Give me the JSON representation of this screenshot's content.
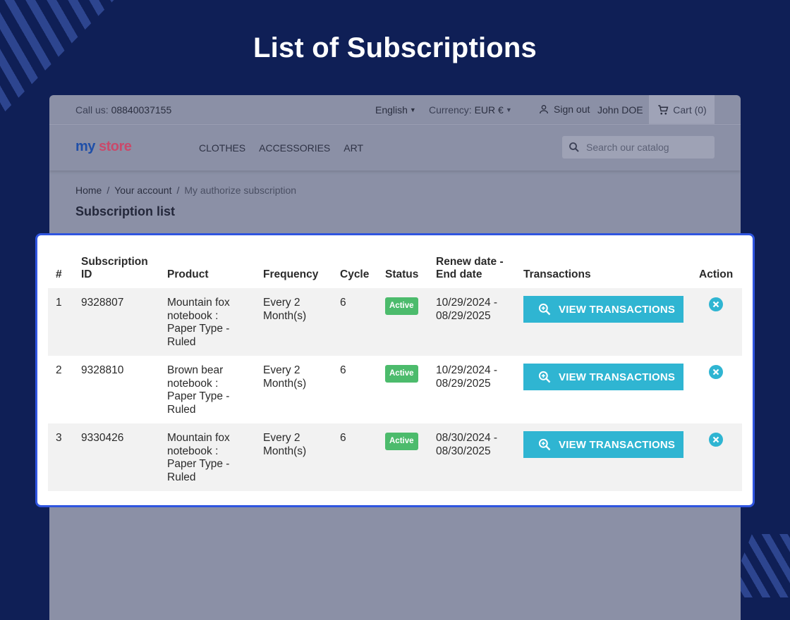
{
  "headline": "List of Subscriptions",
  "store": {
    "topbar": {
      "call_label": "Call us:",
      "phone": "08840037155",
      "language": "English",
      "currency_label": "Currency:",
      "currency_value": "EUR €",
      "sign_out": "Sign out",
      "user_name": "John DOE",
      "cart": "Cart (0)"
    },
    "logo": {
      "part1": "my",
      "part2": "store"
    },
    "menu": [
      "CLOTHES",
      "ACCESSORIES",
      "ART"
    ],
    "search_placeholder": "Search our catalog",
    "breadcrumb": {
      "home": "Home",
      "account": "Your account",
      "current": "My authorize subscription"
    },
    "page_title": "Subscription list"
  },
  "table": {
    "headers": {
      "num": "#",
      "sub_id": "Subscription ID",
      "product": "Product",
      "frequency": "Frequency",
      "cycle": "Cycle",
      "status": "Status",
      "dates": "Renew date - End date",
      "transactions": "Transactions",
      "action": "Action"
    },
    "rows": [
      {
        "num": "1",
        "sub_id": "9328807",
        "product": "Mountain fox notebook : Paper Type - Ruled",
        "frequency": "Every 2 Month(s)",
        "cycle": "6",
        "status": "Active",
        "dates": "10/29/2024 - 08/29/2025",
        "button": "VIEW TRANSACTIONS"
      },
      {
        "num": "2",
        "sub_id": "9328810",
        "product": "Brown bear notebook : Paper Type - Ruled",
        "frequency": "Every 2 Month(s)",
        "cycle": "6",
        "status": "Active",
        "dates": "10/29/2024 - 08/29/2025",
        "button": "VIEW TRANSACTIONS"
      },
      {
        "num": "3",
        "sub_id": "9330426",
        "product": "Mountain fox notebook : Paper Type - Ruled",
        "frequency": "Every 2 Month(s)",
        "cycle": "6",
        "status": "Active",
        "dates": "08/30/2024 - 08/30/2025",
        "button": "VIEW TRANSACTIONS"
      }
    ]
  },
  "colors": {
    "background": "#0f1f56",
    "accent": "#2fb5d2",
    "active_badge": "#4cbb6c",
    "highlight_border": "#2f55e0"
  },
  "icons": {
    "view": "zoom-in-icon",
    "cancel": "close-circle-icon",
    "search": "search-icon",
    "user": "person-icon",
    "cart": "cart-icon"
  }
}
